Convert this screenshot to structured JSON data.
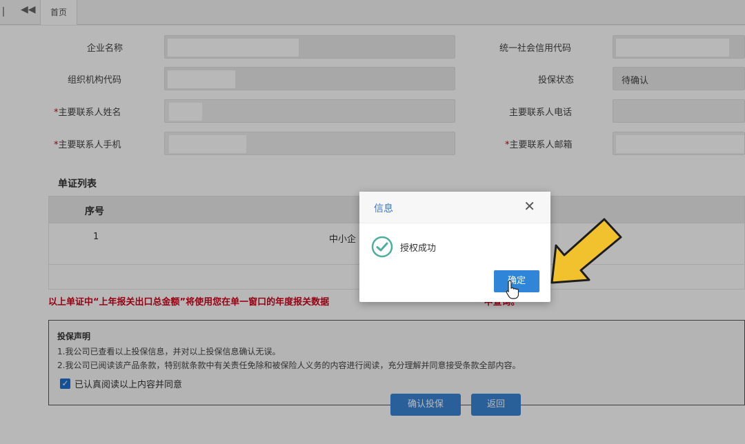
{
  "topbar": {
    "back_icon": "double-chevron-left-icon",
    "home_tab": "首页"
  },
  "form": {
    "company_name": {
      "label": "企业名称",
      "value": ""
    },
    "credit_code": {
      "label": "统一社会信用代码",
      "value": ""
    },
    "org_code": {
      "label": "组织机构代码",
      "value": ""
    },
    "insure_status": {
      "label": "投保状态",
      "value": "待确认"
    },
    "contact_name": {
      "label": "主要联系人姓名",
      "required_mark": "*",
      "value": ""
    },
    "contact_phone": {
      "label": "主要联系人电话",
      "value": ""
    },
    "contact_mobile": {
      "label": "主要联系人手机",
      "required_mark": "*",
      "value": ""
    },
    "contact_email": {
      "label": "主要联系人邮箱",
      "required_mark": "*",
      "value": ""
    }
  },
  "doc_list": {
    "title": "单证列表",
    "columns": [
      "序号"
    ],
    "rows": [
      {
        "index": "1",
        "name": "中小企"
      }
    ]
  },
  "warning": "以上单证中“上年报关出口总金额”将使用您在单一窗口的年度报关数据",
  "warning_tail": "中查询。",
  "declaration": {
    "title": "投保声明",
    "line1": "1.我公司已查看以上投保信息，并对以上投保信息确认无误。",
    "line2": "2.我公司已阅读该产品条款，特别就条款中有关责任免除和被保险人义务的内容进行阅读，充分理解并同意接受条款全部内容。",
    "agree_label": "已认真阅读以上内容并同意",
    "agree_checked": true
  },
  "buttons": {
    "confirm": "确认投保",
    "back": "返回"
  },
  "dialog": {
    "title": "信息",
    "message": "授权成功",
    "ok": "确定",
    "close_icon": "close-icon",
    "status_icon": "check-circle-icon"
  },
  "colors": {
    "accent": "#2f86d8",
    "warning": "#d0021b",
    "annotation_arrow": "#f2c12e"
  }
}
